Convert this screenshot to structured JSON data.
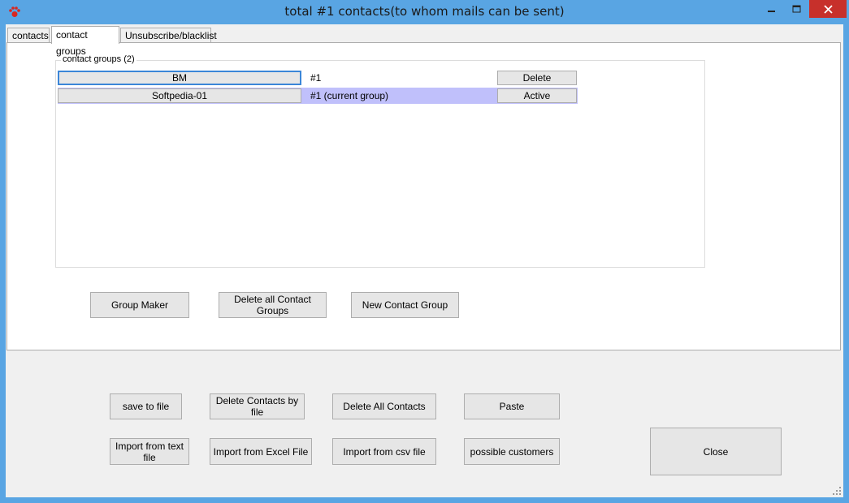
{
  "window": {
    "title": "total #1 contacts(to whom mails can be sent)",
    "icon": "paw-icon",
    "title_bar_color": "#59a5e3"
  },
  "tabs": [
    {
      "label": "contacts"
    },
    {
      "label": "contact groups"
    },
    {
      "label": "Unsubscribe/blacklist"
    }
  ],
  "groups": {
    "title": "contact groups (2)",
    "rows": [
      {
        "name": "BM",
        "count": "#1",
        "action": "Delete"
      },
      {
        "name": "Softpedia-01",
        "count": "#1 (current group)",
        "action": "Active"
      }
    ]
  },
  "group_buttons": {
    "group_maker": "Group Maker",
    "delete_all_groups": "Delete all Contact Groups",
    "new_group": "New Contact Group"
  },
  "bottom_buttons": {
    "save_to_file": "save to file",
    "delete_contacts_by_file": "Delete Contacts by file",
    "delete_all_contacts": "Delete All Contacts",
    "paste": "Paste",
    "import_text": "Import from text file",
    "import_excel": "Import from Excel File",
    "import_csv": "Import from csv file",
    "possible_customers": "possible customers",
    "close": "Close"
  },
  "colors": {
    "current_row": "#c0c0fb",
    "close_control": "#c7302b",
    "selected_border": "#3b86d8"
  }
}
